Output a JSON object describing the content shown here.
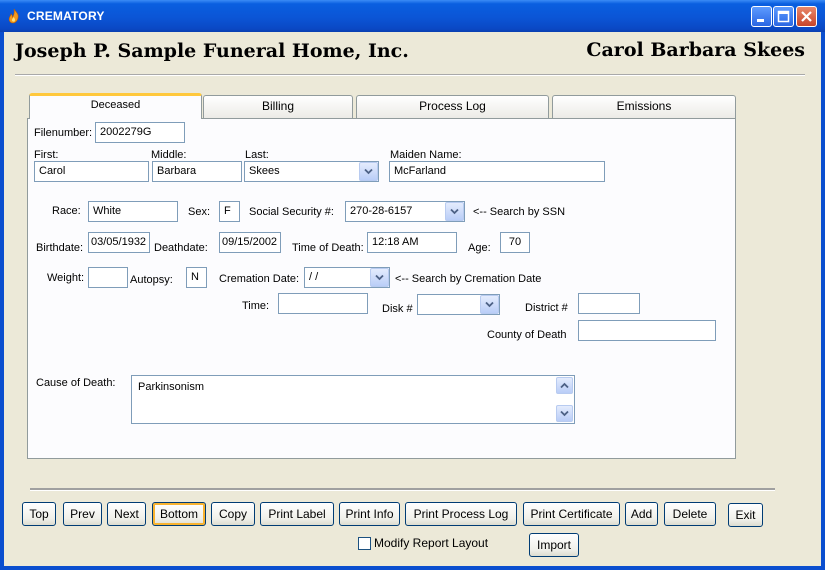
{
  "window": {
    "title": "CREMATORY"
  },
  "header": {
    "business_name": "Joseph P. Sample Funeral Home, Inc.",
    "decedent_name": "Carol Barbara Skees"
  },
  "tabs": [
    {
      "label": "Deceased",
      "active": true
    },
    {
      "label": "Billing",
      "active": false
    },
    {
      "label": "Process Log",
      "active": false
    },
    {
      "label": "Emissions",
      "active": false
    }
  ],
  "form": {
    "filenumber": {
      "label": "Filenumber:",
      "value": "2002279G"
    },
    "first": {
      "label": "First:",
      "value": "Carol"
    },
    "middle": {
      "label": "Middle:",
      "value": "Barbara"
    },
    "last": {
      "label": "Last:",
      "value": "Skees"
    },
    "maiden": {
      "label": "Maiden Name:",
      "value": "McFarland"
    },
    "race": {
      "label": "Race:",
      "value": "White"
    },
    "sex": {
      "label": "Sex:",
      "value": "F"
    },
    "ssn": {
      "label": "Social Security #:",
      "value": "270-28-6157",
      "hint": "<-- Search by SSN"
    },
    "birthdate": {
      "label": "Birthdate:",
      "value": "03/05/1932"
    },
    "deathdate": {
      "label": "Deathdate:",
      "value": "09/15/2002"
    },
    "time_of_death": {
      "label": "Time of Death:",
      "value": "12:18 AM"
    },
    "age": {
      "label": "Age:",
      "value": "70"
    },
    "weight": {
      "label": "Weight:",
      "value": ""
    },
    "autopsy": {
      "label": "Autopsy:",
      "value": "N"
    },
    "cremation_date": {
      "label": "Cremation Date:",
      "value": " / /",
      "hint": "<-- Search by Cremation Date"
    },
    "time": {
      "label": "Time:",
      "value": ""
    },
    "disk": {
      "label": "Disk #",
      "value": ""
    },
    "district": {
      "label": "District #",
      "value": ""
    },
    "county": {
      "label": "County of Death",
      "value": ""
    },
    "cause": {
      "label": "Cause of Death:",
      "value": "Parkinsonism"
    }
  },
  "buttons": {
    "top": "Top",
    "prev": "Prev",
    "next": "Next",
    "bottom": "Bottom",
    "copy": "Copy",
    "print_label": "Print Label",
    "print_info": "Print Info",
    "print_process_log": "Print Process Log",
    "print_certificate": "Print Certificate",
    "add": "Add",
    "delete": "Delete",
    "exit": "Exit",
    "import": "Import"
  },
  "modify_report_layout": {
    "label": "Modify Report Layout",
    "checked": false
  },
  "colors": {
    "titlebar": "#0A55D6",
    "background": "#ECE9D8",
    "active_tab_accent": "#FFC83C"
  }
}
